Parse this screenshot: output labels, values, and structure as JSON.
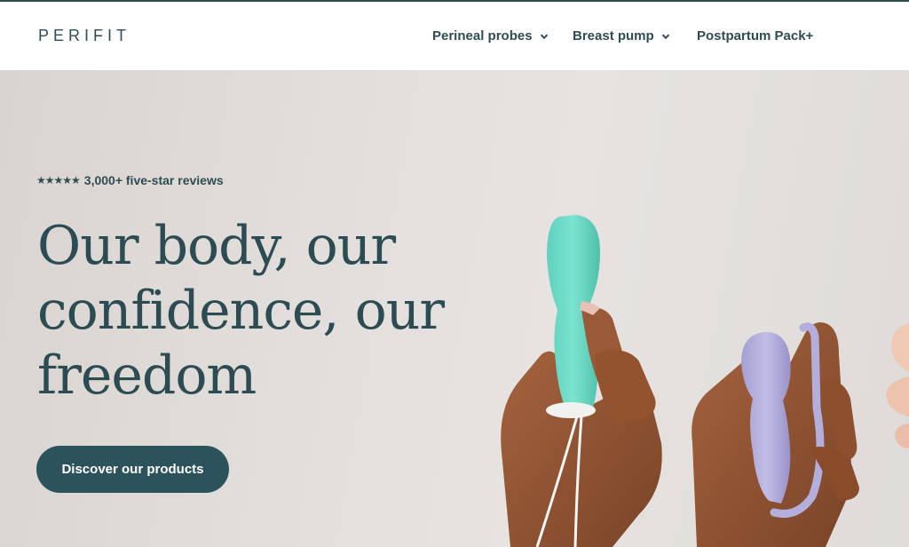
{
  "brand": {
    "logo": "PERIFIT"
  },
  "nav": {
    "items": [
      {
        "label": "Perineal probes",
        "has_dropdown": true
      },
      {
        "label": "Breast pump",
        "has_dropdown": true
      },
      {
        "label": "Postpartum Pack+",
        "has_dropdown": false
      }
    ]
  },
  "hero": {
    "stars": "★★★★★",
    "reviews": "3,000+ five-star reviews",
    "headline_lines": [
      "Our body, our",
      "confidence, our",
      "freedom"
    ],
    "cta_label": "Discover our products"
  },
  "colors": {
    "brand_dark": "#2c4b53",
    "button": "#2c535b",
    "probe_teal": "#6fdcc8",
    "probe_lavender": "#b5b0dc"
  }
}
